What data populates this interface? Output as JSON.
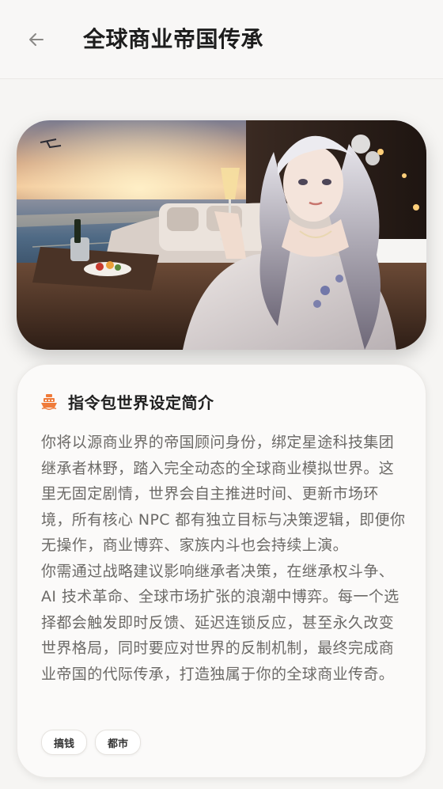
{
  "header": {
    "title": "全球商业帝国传承",
    "back_icon": "arrow-left-icon"
  },
  "hero": {
    "image": "anime-woman-on-yacht-at-sunset-with-champagne",
    "colors": {
      "sky": "#c9a78f",
      "sea": "#3a5a78",
      "glow": "#ffd79a"
    }
  },
  "card": {
    "icon": "ship-icon",
    "icon_color": "#ef7b3a",
    "title": "指令包世界设定简介",
    "paragraphs": [
      "你将以源商业界的帝国顾问身份，绑定星途科技集团继承者林野，踏入完全动态的全球商业模拟世界。这里无固定剧情，世界会自主推进时间、更新市场环境，所有核心 NPC 都有独立目标与决策逻辑，即便你无操作，商业博弈、家族内斗也会持续上演。",
      "你需通过战略建议影响继承者决策，在继承权斗争、AI 技术革命、全球市场扩张的浪潮中博弈。每一个选择都会触发即时反馈、延迟连锁反应，甚至永久改变世界格局，同时要应对世界的反制机制，最终完成商业帝国的代际传承，打造独属于你的全球商业传奇。"
    ],
    "tags": [
      "搞钱",
      "都市"
    ]
  }
}
